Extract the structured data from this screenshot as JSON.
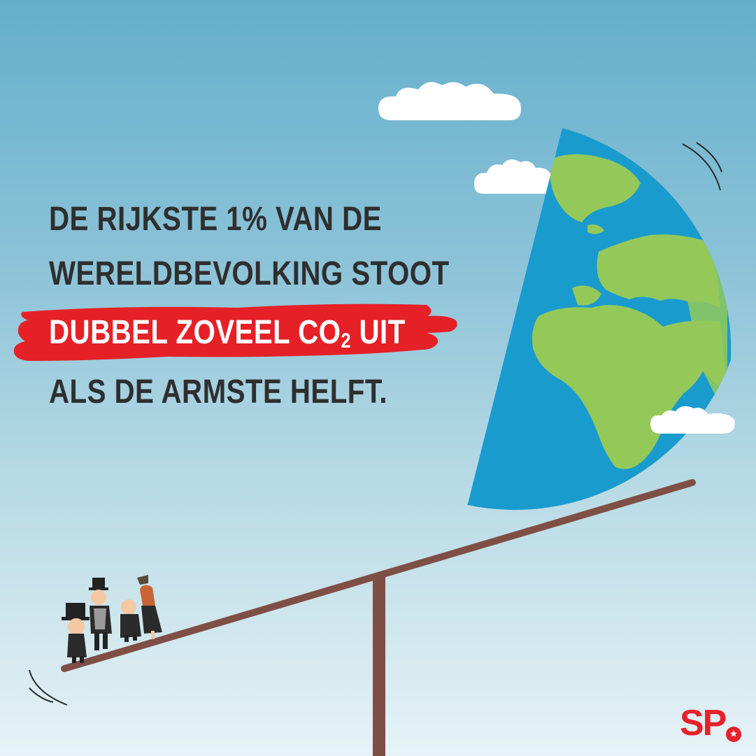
{
  "headline": {
    "line1": "DE RIJKSTE 1% VAN DE",
    "line2": "WERELDBEVOLKING STOOT",
    "line3_before": "DUBBEL ZOVEEL CO",
    "line3_subscript": "2",
    "line3_after": " UIT",
    "line4": "ALS DE ARMSTE HELFT."
  },
  "logo": {
    "text": "SP"
  },
  "colors": {
    "sky_top": "#64afcb",
    "sky_bottom": "#e6f2f6",
    "highlight_red": "#e52127",
    "text_dark": "#2f2f2f",
    "ocean": "#1a9bce",
    "land": "#94c95a",
    "seesaw": "#7f4f45",
    "logo_red": "#e8202a"
  }
}
